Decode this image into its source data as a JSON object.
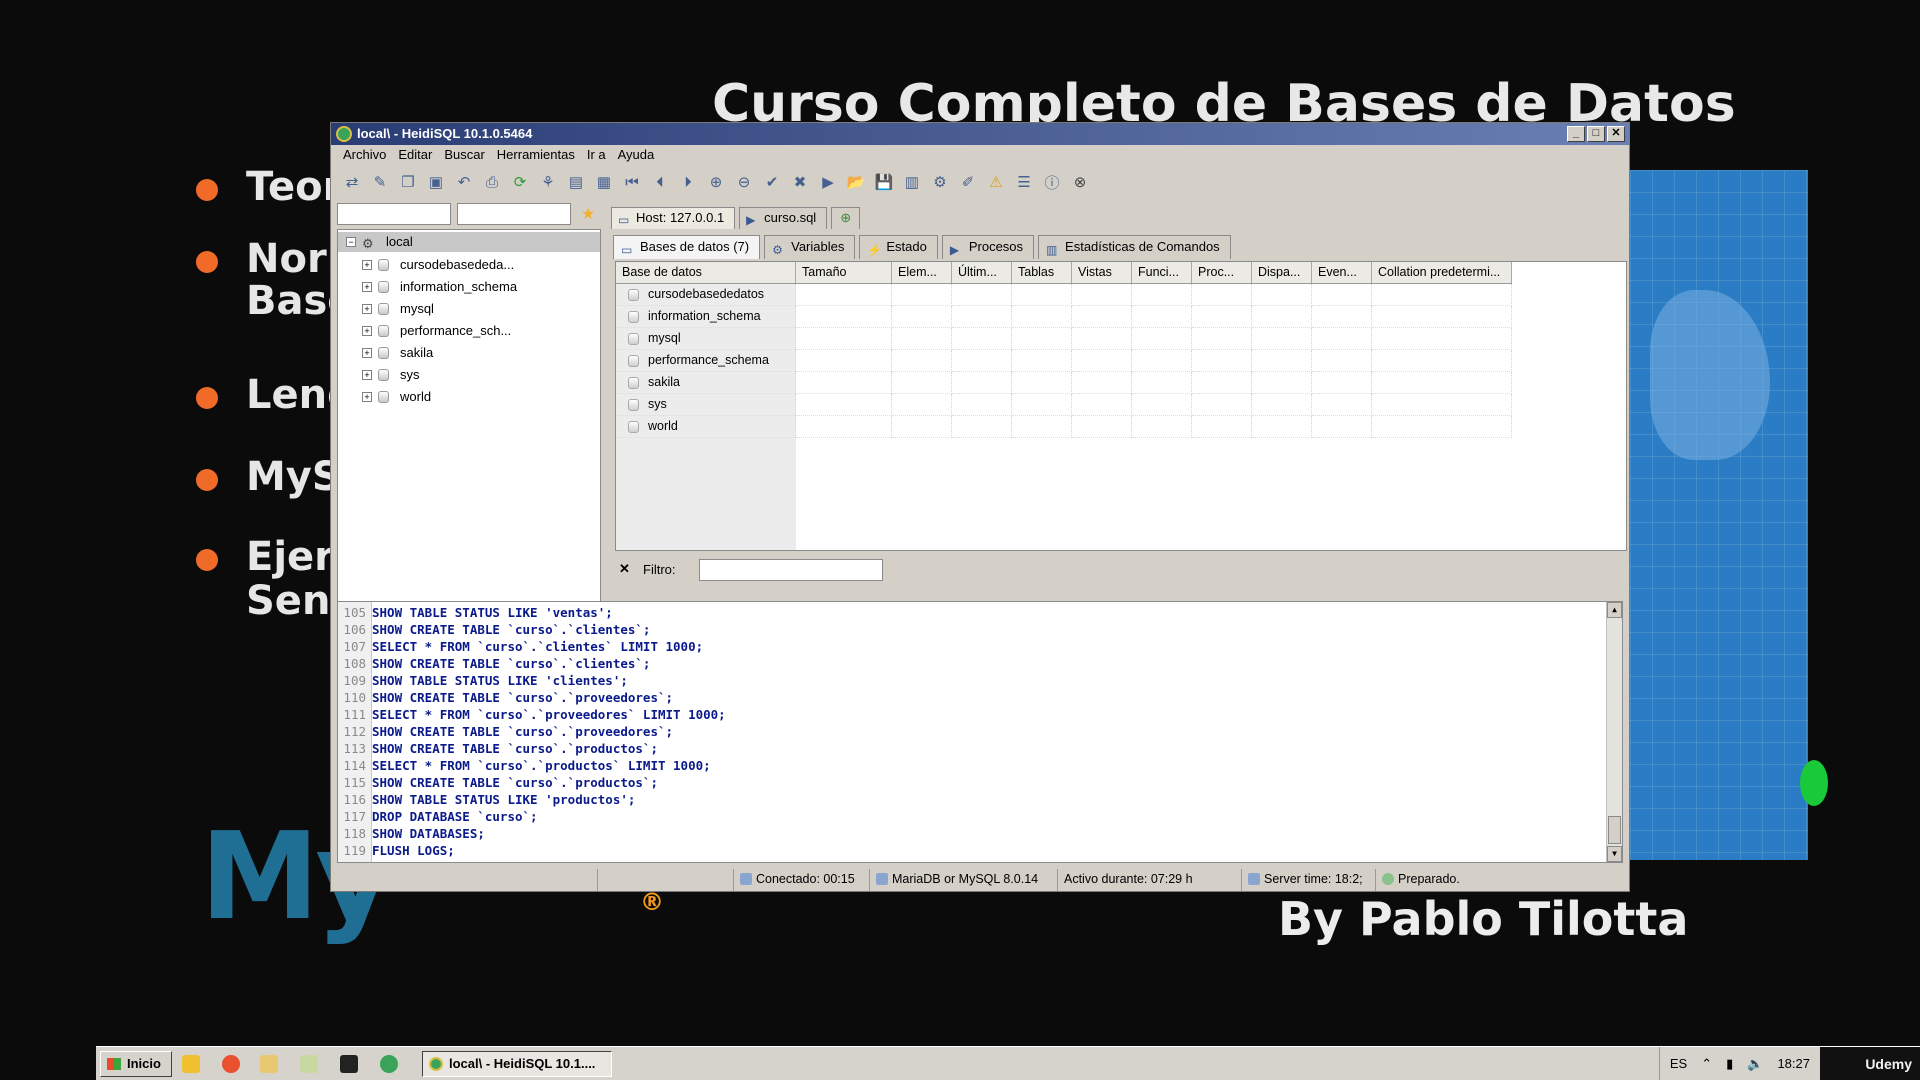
{
  "slide": {
    "title": "Curso Completo de Bases de Datos",
    "bullets": [
      "Teor",
      "Norr",
      "Base",
      "Leng",
      "MyS",
      "Ejerc",
      "Sent"
    ],
    "logo_text": "My",
    "logo_mark": "®",
    "byline": "By Pablo Tilotta"
  },
  "window": {
    "title": "local\\ - HeidiSQL 10.1.0.5464",
    "controls": [
      "_",
      "□",
      "✕"
    ]
  },
  "menu": [
    "Archivo",
    "Editar",
    "Buscar",
    "Herramientas",
    "Ir a",
    "Ayuda"
  ],
  "toolbar_icons": [
    "connect-icon",
    "disconnect-icon",
    "copy-icon",
    "paste-icon",
    "undo-icon",
    "print-icon",
    "refresh-icon",
    "export-icon",
    "import-icon",
    "first-icon",
    "prev-icon",
    "next-icon",
    "add-icon",
    "remove-icon",
    "check-icon",
    "cancel-icon",
    "run-icon",
    "open-icon",
    "save-icon",
    "warning-icon",
    "help-icon",
    "stop-icon"
  ],
  "tree": {
    "root": "local",
    "items": [
      "cursodebasededa...",
      "information_schema",
      "mysql",
      "performance_sch...",
      "sakila",
      "sys",
      "world"
    ]
  },
  "tabs": {
    "outer": [
      {
        "label": "Host: 127.0.0.1",
        "active": true
      },
      {
        "label": "curso.sql",
        "active": false
      }
    ],
    "inner": [
      {
        "label": "Bases de datos (7)",
        "active": true
      },
      {
        "label": "Variables",
        "active": false
      },
      {
        "label": "Estado",
        "active": false
      },
      {
        "label": "Procesos",
        "active": false
      },
      {
        "label": "Estadísticas de Comandos",
        "active": false
      }
    ]
  },
  "grid": {
    "columns": [
      "Base de datos",
      "Tamaño",
      "Elem...",
      "Últim...",
      "Tablas",
      "Vistas",
      "Funci...",
      "Proc...",
      "Dispa...",
      "Even...",
      "Collation predetermi..."
    ],
    "rows": [
      "cursodebasededatos",
      "information_schema",
      "mysql",
      "performance_schema",
      "sakila",
      "sys",
      "world"
    ]
  },
  "filter": {
    "close": "✕",
    "label": "Filtro:",
    "value": ""
  },
  "sql_log": [
    {
      "n": "105",
      "code": "SHOW TABLE STATUS LIKE 'ventas';"
    },
    {
      "n": "106",
      "code": "SHOW CREATE TABLE `curso`.`clientes`;"
    },
    {
      "n": "107",
      "code": "SELECT * FROM `curso`.`clientes` LIMIT 1000;"
    },
    {
      "n": "108",
      "code": "SHOW CREATE TABLE `curso`.`clientes`;"
    },
    {
      "n": "109",
      "code": "SHOW TABLE STATUS LIKE 'clientes';"
    },
    {
      "n": "110",
      "code": "SHOW CREATE TABLE `curso`.`proveedores`;"
    },
    {
      "n": "111",
      "code": "SELECT * FROM `curso`.`proveedores` LIMIT 1000;"
    },
    {
      "n": "112",
      "code": "SHOW CREATE TABLE `curso`.`proveedores`;"
    },
    {
      "n": "113",
      "code": "SHOW CREATE TABLE `curso`.`productos`;"
    },
    {
      "n": "114",
      "code": "SELECT * FROM `curso`.`productos` LIMIT 1000;"
    },
    {
      "n": "115",
      "code": "SHOW CREATE TABLE `curso`.`productos`;"
    },
    {
      "n": "116",
      "code": "SHOW TABLE STATUS LIKE 'productos';"
    },
    {
      "n": "117",
      "code": "DROP DATABASE `curso`;"
    },
    {
      "n": "118",
      "code": "SHOW DATABASES;"
    },
    {
      "n": "119",
      "code": "FLUSH LOGS;"
    }
  ],
  "status": {
    "connected": "Conectado: 00:15",
    "server": "MariaDB or MySQL 8.0.14",
    "uptime": "Activo durante: 07:29 h",
    "server_time": "Server time: 18:2;",
    "state": "Preparado."
  },
  "taskbar": {
    "start": "Inicio",
    "task": "local\\ - HeidiSQL 10.1....",
    "lang": "ES",
    "clock": "18:27",
    "watermark": "Udemy"
  }
}
